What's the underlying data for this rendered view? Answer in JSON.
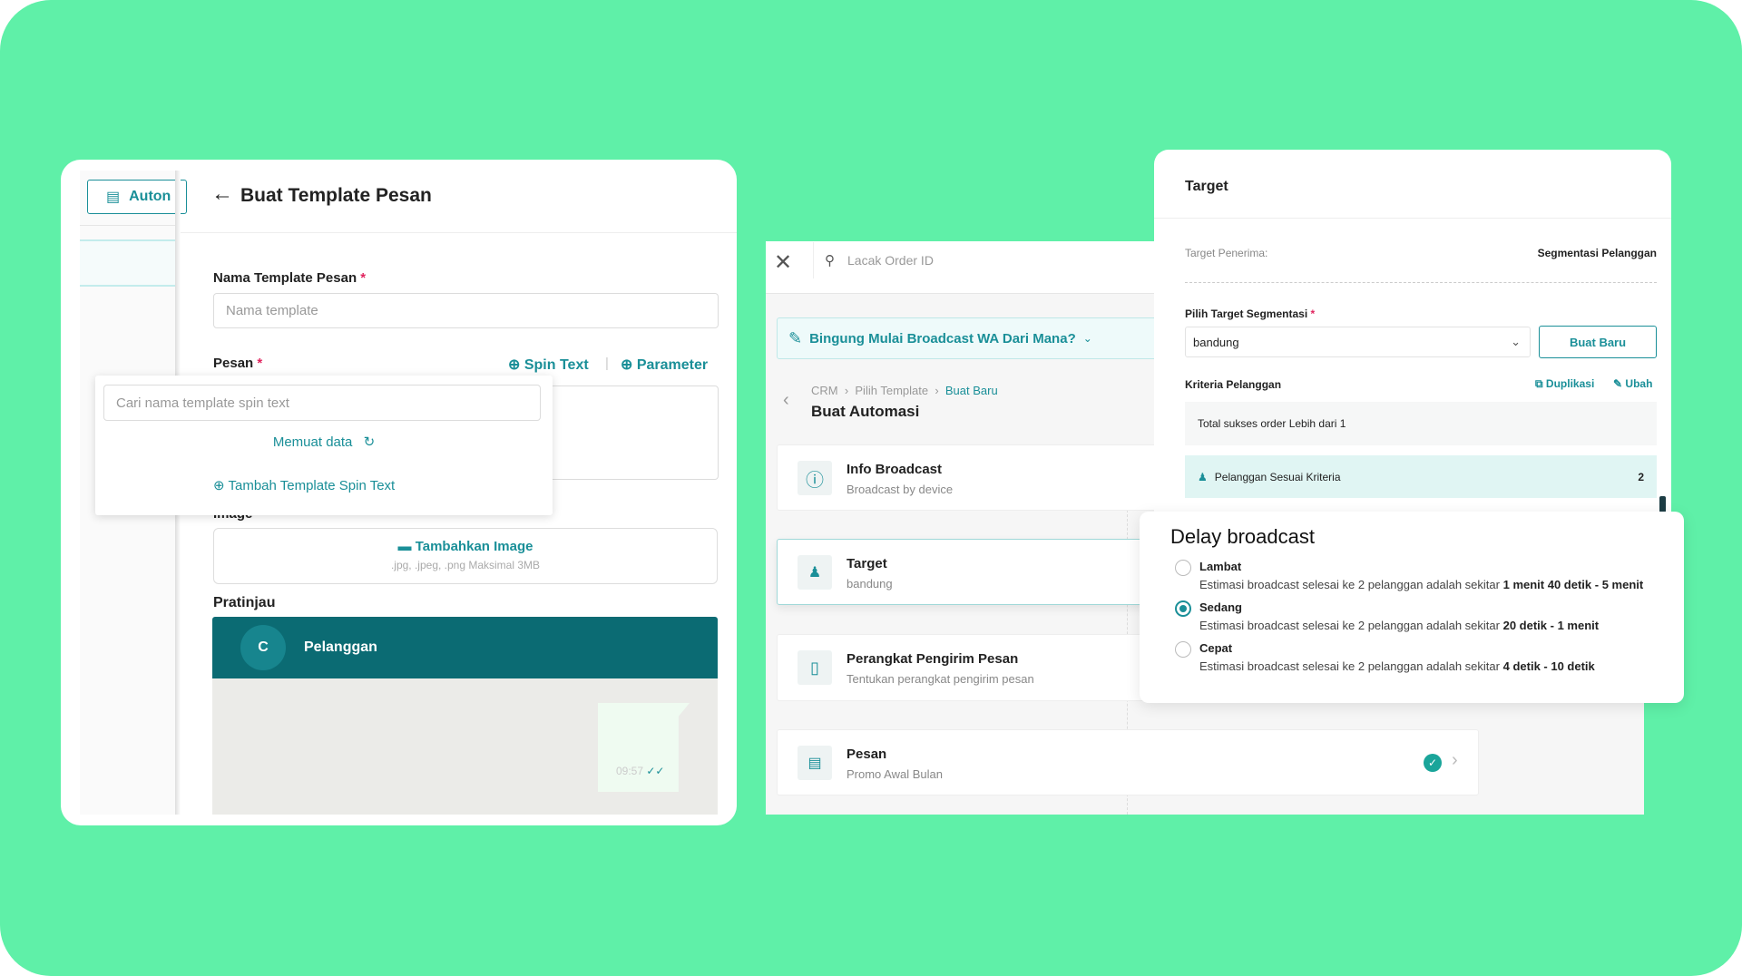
{
  "colors": {
    "background": "#5ff0a8",
    "accent": "#1a8f98",
    "preview_header": "#0b6b73"
  },
  "left_panel": {
    "sidebar_button": "Auton",
    "title": "Buat Template Pesan",
    "name_label": "Nama Template Pesan",
    "required": "*",
    "name_placeholder": "Nama template",
    "message_label": "Pesan",
    "spin_text": "Spin Text",
    "separator": "|",
    "parameter": "Parameter",
    "dropdown": {
      "search_placeholder": "Cari nama template spin text",
      "loading": "Memuat data",
      "add": "Tambah Template Spin Text"
    },
    "image_label": "Image",
    "upload": {
      "label": "Tambahkan Image",
      "hint": ".jpg, .jpeg, .png Maksimal 3MB"
    },
    "preview_label": "Pratinjau",
    "preview": {
      "avatar": "C",
      "name": "Pelanggan",
      "time": "09:57"
    }
  },
  "middle_panel": {
    "search_placeholder": "Lacak Order ID",
    "banner": "Bingung Mulai Broadcast WA Dari Mana?",
    "breadcrumb": [
      "CRM",
      "Pilih Template",
      "Buat Baru"
    ],
    "title": "Buat Automasi",
    "steps": [
      {
        "title": "Info Broadcast",
        "subtitle": "Broadcast by device",
        "icon": "info-icon"
      },
      {
        "title": "Target",
        "subtitle": "bandung",
        "icon": "users-icon"
      },
      {
        "title": "Perangkat Pengirim Pesan",
        "subtitle": "Tentukan perangkat pengirim pesan",
        "icon": "phone-icon"
      },
      {
        "title": "Pesan",
        "subtitle": "Promo Awal Bulan",
        "icon": "message-icon",
        "completed": true
      }
    ]
  },
  "target_panel": {
    "title": "Target",
    "recipient_label": "Target Penerima:",
    "recipient_value": "Segmentasi Pelanggan",
    "segment_label": "Pilih Target Segmentasi",
    "required": "*",
    "segment_value": "bandung",
    "new_button": "Buat Baru",
    "criteria_label": "Kriteria Pelanggan",
    "duplicate": "Duplikasi",
    "edit": "Ubah",
    "criteria": "Total sukses order Lebih dari 1",
    "matching_label": "Pelanggan Sesuai Kriteria",
    "matching_count": "2"
  },
  "delay": {
    "title": "Delay broadcast",
    "selected": "Sedang",
    "options": [
      {
        "label": "Lambat",
        "prefix": "Estimasi broadcast selesai ke 2 pelanggan adalah sekitar",
        "range": "1 menit 40 detik - 5 menit"
      },
      {
        "label": "Sedang",
        "prefix": "Estimasi broadcast selesai ke 2 pelanggan adalah sekitar",
        "range": "20 detik - 1 menit"
      },
      {
        "label": "Cepat",
        "prefix": "Estimasi broadcast selesai ke 2 pelanggan adalah sekitar",
        "range": "4 detik - 10 detik"
      }
    ]
  }
}
